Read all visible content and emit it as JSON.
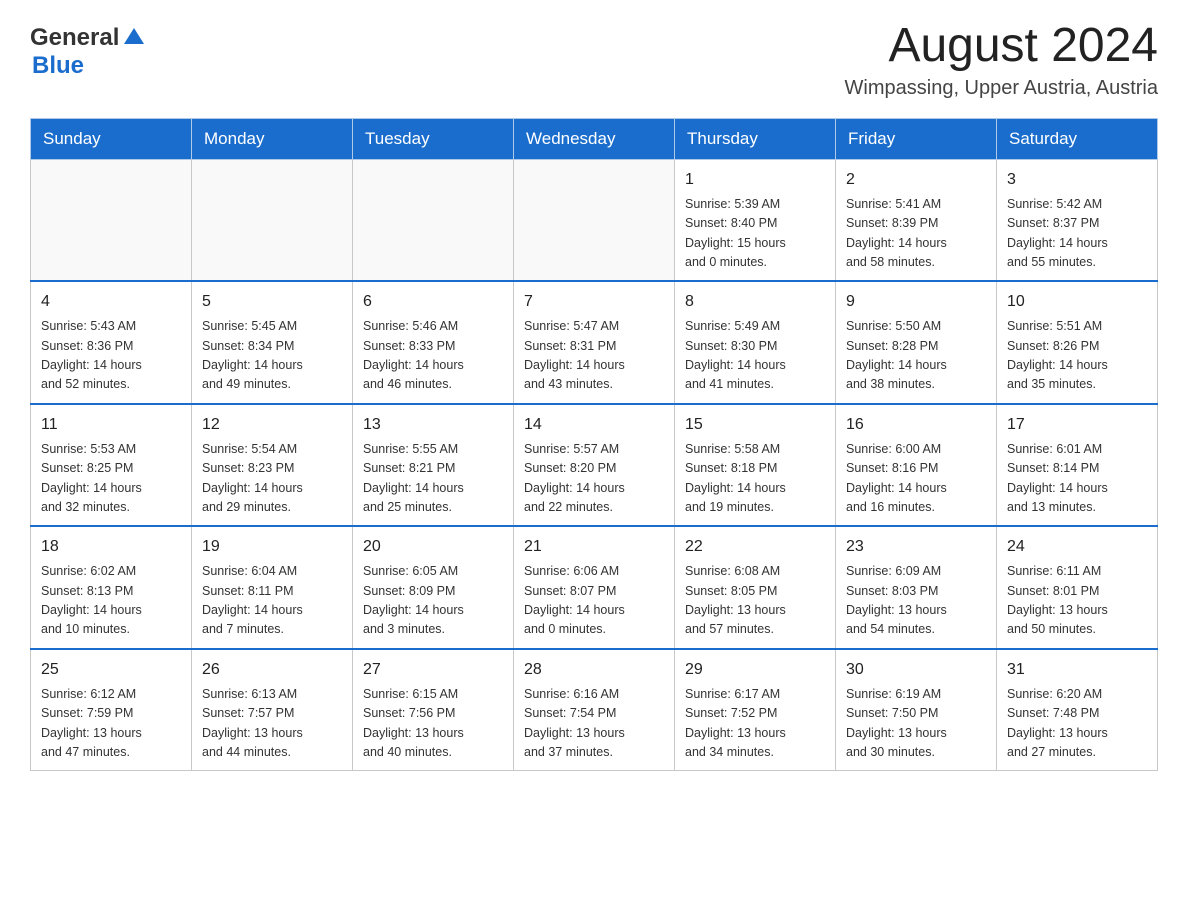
{
  "header": {
    "logo_general": "General",
    "logo_blue": "Blue",
    "month_year": "August 2024",
    "location": "Wimpassing, Upper Austria, Austria"
  },
  "days_of_week": [
    "Sunday",
    "Monday",
    "Tuesday",
    "Wednesday",
    "Thursday",
    "Friday",
    "Saturday"
  ],
  "weeks": [
    [
      {
        "day": "",
        "info": ""
      },
      {
        "day": "",
        "info": ""
      },
      {
        "day": "",
        "info": ""
      },
      {
        "day": "",
        "info": ""
      },
      {
        "day": "1",
        "info": "Sunrise: 5:39 AM\nSunset: 8:40 PM\nDaylight: 15 hours\nand 0 minutes."
      },
      {
        "day": "2",
        "info": "Sunrise: 5:41 AM\nSunset: 8:39 PM\nDaylight: 14 hours\nand 58 minutes."
      },
      {
        "day": "3",
        "info": "Sunrise: 5:42 AM\nSunset: 8:37 PM\nDaylight: 14 hours\nand 55 minutes."
      }
    ],
    [
      {
        "day": "4",
        "info": "Sunrise: 5:43 AM\nSunset: 8:36 PM\nDaylight: 14 hours\nand 52 minutes."
      },
      {
        "day": "5",
        "info": "Sunrise: 5:45 AM\nSunset: 8:34 PM\nDaylight: 14 hours\nand 49 minutes."
      },
      {
        "day": "6",
        "info": "Sunrise: 5:46 AM\nSunset: 8:33 PM\nDaylight: 14 hours\nand 46 minutes."
      },
      {
        "day": "7",
        "info": "Sunrise: 5:47 AM\nSunset: 8:31 PM\nDaylight: 14 hours\nand 43 minutes."
      },
      {
        "day": "8",
        "info": "Sunrise: 5:49 AM\nSunset: 8:30 PM\nDaylight: 14 hours\nand 41 minutes."
      },
      {
        "day": "9",
        "info": "Sunrise: 5:50 AM\nSunset: 8:28 PM\nDaylight: 14 hours\nand 38 minutes."
      },
      {
        "day": "10",
        "info": "Sunrise: 5:51 AM\nSunset: 8:26 PM\nDaylight: 14 hours\nand 35 minutes."
      }
    ],
    [
      {
        "day": "11",
        "info": "Sunrise: 5:53 AM\nSunset: 8:25 PM\nDaylight: 14 hours\nand 32 minutes."
      },
      {
        "day": "12",
        "info": "Sunrise: 5:54 AM\nSunset: 8:23 PM\nDaylight: 14 hours\nand 29 minutes."
      },
      {
        "day": "13",
        "info": "Sunrise: 5:55 AM\nSunset: 8:21 PM\nDaylight: 14 hours\nand 25 minutes."
      },
      {
        "day": "14",
        "info": "Sunrise: 5:57 AM\nSunset: 8:20 PM\nDaylight: 14 hours\nand 22 minutes."
      },
      {
        "day": "15",
        "info": "Sunrise: 5:58 AM\nSunset: 8:18 PM\nDaylight: 14 hours\nand 19 minutes."
      },
      {
        "day": "16",
        "info": "Sunrise: 6:00 AM\nSunset: 8:16 PM\nDaylight: 14 hours\nand 16 minutes."
      },
      {
        "day": "17",
        "info": "Sunrise: 6:01 AM\nSunset: 8:14 PM\nDaylight: 14 hours\nand 13 minutes."
      }
    ],
    [
      {
        "day": "18",
        "info": "Sunrise: 6:02 AM\nSunset: 8:13 PM\nDaylight: 14 hours\nand 10 minutes."
      },
      {
        "day": "19",
        "info": "Sunrise: 6:04 AM\nSunset: 8:11 PM\nDaylight: 14 hours\nand 7 minutes."
      },
      {
        "day": "20",
        "info": "Sunrise: 6:05 AM\nSunset: 8:09 PM\nDaylight: 14 hours\nand 3 minutes."
      },
      {
        "day": "21",
        "info": "Sunrise: 6:06 AM\nSunset: 8:07 PM\nDaylight: 14 hours\nand 0 minutes."
      },
      {
        "day": "22",
        "info": "Sunrise: 6:08 AM\nSunset: 8:05 PM\nDaylight: 13 hours\nand 57 minutes."
      },
      {
        "day": "23",
        "info": "Sunrise: 6:09 AM\nSunset: 8:03 PM\nDaylight: 13 hours\nand 54 minutes."
      },
      {
        "day": "24",
        "info": "Sunrise: 6:11 AM\nSunset: 8:01 PM\nDaylight: 13 hours\nand 50 minutes."
      }
    ],
    [
      {
        "day": "25",
        "info": "Sunrise: 6:12 AM\nSunset: 7:59 PM\nDaylight: 13 hours\nand 47 minutes."
      },
      {
        "day": "26",
        "info": "Sunrise: 6:13 AM\nSunset: 7:57 PM\nDaylight: 13 hours\nand 44 minutes."
      },
      {
        "day": "27",
        "info": "Sunrise: 6:15 AM\nSunset: 7:56 PM\nDaylight: 13 hours\nand 40 minutes."
      },
      {
        "day": "28",
        "info": "Sunrise: 6:16 AM\nSunset: 7:54 PM\nDaylight: 13 hours\nand 37 minutes."
      },
      {
        "day": "29",
        "info": "Sunrise: 6:17 AM\nSunset: 7:52 PM\nDaylight: 13 hours\nand 34 minutes."
      },
      {
        "day": "30",
        "info": "Sunrise: 6:19 AM\nSunset: 7:50 PM\nDaylight: 13 hours\nand 30 minutes."
      },
      {
        "day": "31",
        "info": "Sunrise: 6:20 AM\nSunset: 7:48 PM\nDaylight: 13 hours\nand 27 minutes."
      }
    ]
  ]
}
